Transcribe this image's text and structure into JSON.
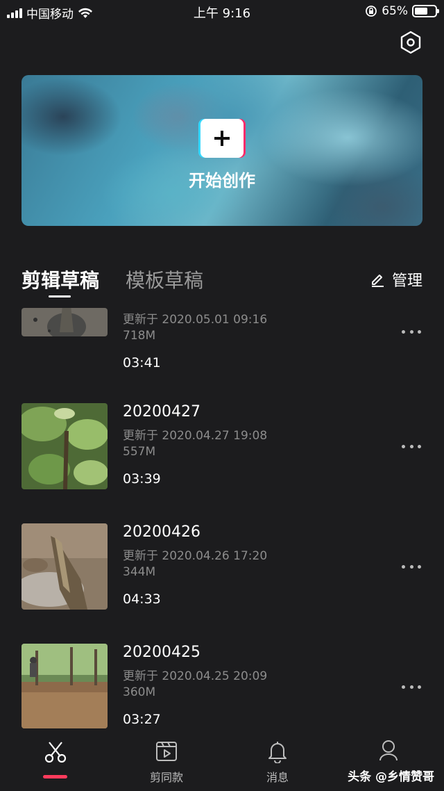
{
  "status_bar": {
    "carrier": "中国移动",
    "time": "上午 9:16",
    "battery": "65%",
    "battery_level": 0.65
  },
  "banner": {
    "label": "开始创作",
    "icon": "plus-icon"
  },
  "tabs": [
    {
      "label": "剪辑草稿",
      "active": true
    },
    {
      "label": "模板草稿",
      "active": false
    }
  ],
  "manage": {
    "label": "管理",
    "icon": "edit-icon"
  },
  "drafts": [
    {
      "title": "",
      "updated": "更新于 2020.05.01 09:16",
      "size": "718M",
      "duration": "03:41"
    },
    {
      "title": "20200427",
      "updated": "更新于 2020.04.27 19:08",
      "size": "557M",
      "duration": "03:39"
    },
    {
      "title": "20200426",
      "updated": "更新于 2020.04.26 17:20",
      "size": "344M",
      "duration": "04:33"
    },
    {
      "title": "20200425",
      "updated": "更新于 2020.04.25 20:09",
      "size": "360M",
      "duration": "03:27"
    }
  ],
  "bottom_nav": {
    "items": [
      {
        "label": "",
        "icon": "scissors-icon",
        "active": true
      },
      {
        "label": "剪同款",
        "icon": "video-template-icon",
        "active": false
      },
      {
        "label": "消息",
        "icon": "bell-icon",
        "active": false
      },
      {
        "label": "",
        "icon": "profile-icon",
        "active": false
      }
    ],
    "watermark": "头条 @乡情赞哥"
  },
  "colors": {
    "background": "#1c1c1e",
    "accent": "#ff3b5c",
    "secondary_text": "#8c8c8c"
  }
}
